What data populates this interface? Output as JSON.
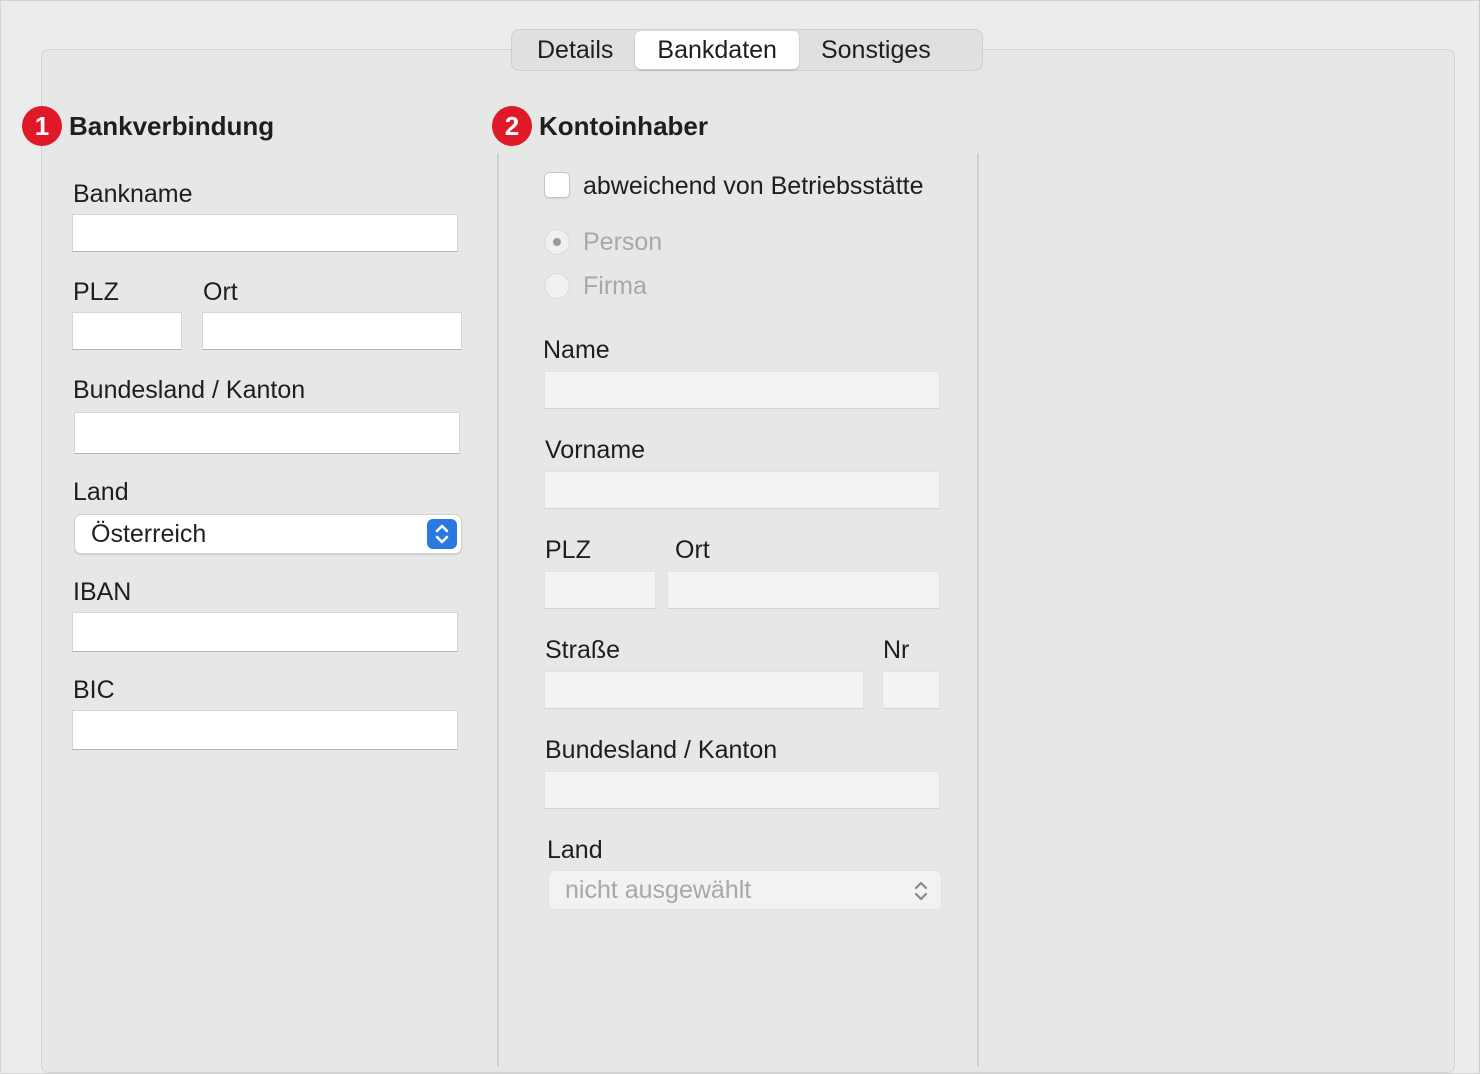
{
  "tabs": [
    {
      "label": "Details",
      "active": false
    },
    {
      "label": "Bankdaten",
      "active": true
    },
    {
      "label": "Sonstiges",
      "active": false
    }
  ],
  "bank": {
    "badge": "1",
    "title": "Bankverbindung",
    "bankname_label": "Bankname",
    "bankname_value": "",
    "plz_label": "PLZ",
    "plz_value": "",
    "ort_label": "Ort",
    "ort_value": "",
    "bundesland_label": "Bundesland / Kanton",
    "bundesland_value": "",
    "land_label": "Land",
    "land_value": "Österreich",
    "iban_label": "IBAN",
    "iban_value": "",
    "bic_label": "BIC",
    "bic_value": ""
  },
  "holder": {
    "badge": "2",
    "title": "Kontoinhaber",
    "checkbox_label": "abweichend von Betriebsstätte",
    "checkbox_checked": false,
    "radio_person": "Person",
    "radio_firma": "Firma",
    "radio_selected": "Person",
    "name_label": "Name",
    "vorname_label": "Vorname",
    "plz_label": "PLZ",
    "ort_label": "Ort",
    "strasse_label": "Straße",
    "nr_label": "Nr",
    "bundesland_label": "Bundesland / Kanton",
    "land_label": "Land",
    "land_value": "nicht ausgewählt"
  },
  "colors": {
    "badge": "#e01929",
    "accent": "#2b79e0",
    "panel": "#e6e7e7"
  }
}
